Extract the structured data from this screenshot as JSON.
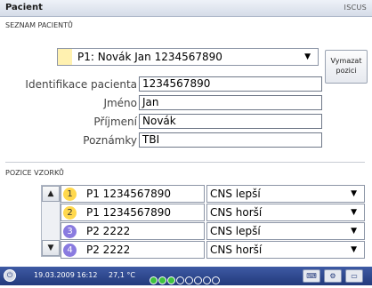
{
  "window": {
    "title": "Pacient",
    "brand": "ISCUS"
  },
  "patients_section": {
    "label": "SEZNAM PACIENTŮ",
    "selected": "P1: Novák Jan 1234567890",
    "delete_button": "Vymazat pozici"
  },
  "fields": [
    {
      "label": "Identifikace pacienta",
      "value": "1234567890"
    },
    {
      "label": "Jméno",
      "value": "Jan"
    },
    {
      "label": "Příjmení",
      "value": "Novák"
    },
    {
      "label": "Poznámky",
      "value": "TBI"
    }
  ],
  "samples_section": {
    "label": "POZICE VZORKŮ",
    "rows": [
      {
        "num": "1",
        "patient": "P1 1234567890",
        "cns": "CNS lepší",
        "color": "#ffd84d"
      },
      {
        "num": "2",
        "patient": "P1 1234567890",
        "cns": "CNS horší",
        "color": "#ffd84d"
      },
      {
        "num": "3",
        "patient": "P2 2222",
        "cns": "CNS lepší",
        "color": "#8a7be0"
      },
      {
        "num": "4",
        "patient": "P2 2222",
        "cns": "CNS horší",
        "color": "#8a7be0"
      }
    ]
  },
  "taskbar": {
    "date": "19.03.2009 16:12",
    "temp": "27,1 °C",
    "dot_colors": [
      "#3ec23e",
      "#3ec23e",
      "#3ec23e",
      "#ffffff",
      "#ffffff",
      "#ffffff",
      "#ffffff",
      "#ffffff"
    ]
  }
}
